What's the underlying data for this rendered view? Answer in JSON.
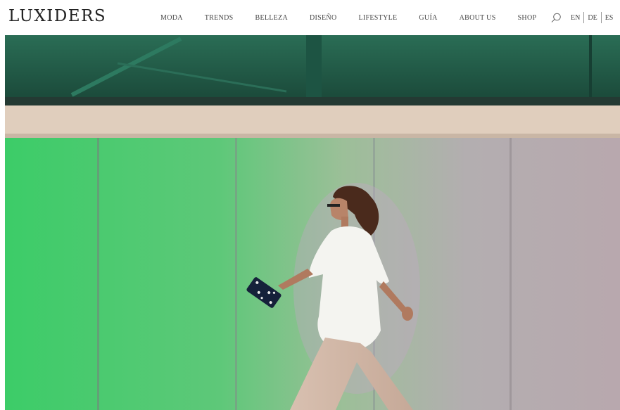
{
  "site": {
    "logo": "LUXIDERS"
  },
  "nav": {
    "items": [
      {
        "label": "MODA"
      },
      {
        "label": "TRENDS"
      },
      {
        "label": "BELLEZA"
      },
      {
        "label": "DISEÑO"
      },
      {
        "label": "LIFESTYLE"
      },
      {
        "label": "GUÍA"
      },
      {
        "label": "ABOUT US"
      },
      {
        "label": "SHOP"
      }
    ]
  },
  "tools": {
    "search_icon": "search-icon",
    "languages": [
      {
        "label": "EN"
      },
      {
        "label": "DE"
      },
      {
        "label": "ES"
      }
    ]
  },
  "hero": {
    "description_icon": "hero-image",
    "colors": {
      "green_panel": "#3fd06a",
      "silver_panel": "#b5aeb2",
      "ledge": "#e2d2c0",
      "glass": "#1f5a48"
    }
  }
}
